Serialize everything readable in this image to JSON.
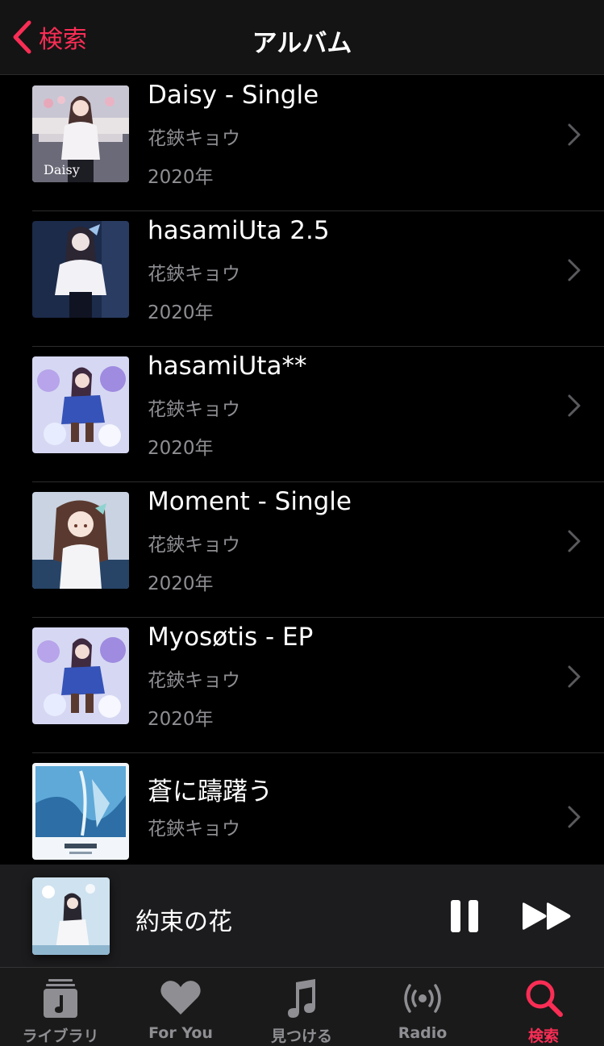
{
  "nav": {
    "back_label": "検索",
    "title": "アルバム"
  },
  "albums": [
    {
      "title": "Daisy - Single",
      "artist": "花鋏キョウ",
      "year": "2020年"
    },
    {
      "title": "hasamiUta 2.5",
      "artist": "花鋏キョウ",
      "year": "2020年"
    },
    {
      "title": "hasamiUta**",
      "artist": "花鋏キョウ",
      "year": "2020年"
    },
    {
      "title": "Moment - Single",
      "artist": "花鋏キョウ",
      "year": "2020年"
    },
    {
      "title": "Myosøtis - EP",
      "artist": "花鋏キョウ",
      "year": "2020年"
    },
    {
      "title": "蒼に躊躇う",
      "artist": "花鋏キョウ",
      "year": ""
    }
  ],
  "now_playing": {
    "song": "約束の花"
  },
  "tabs": [
    {
      "label": "ライブラリ",
      "icon": "library-icon"
    },
    {
      "label": "For You",
      "icon": "heart-icon"
    },
    {
      "label": "見つける",
      "icon": "music-note-icon"
    },
    {
      "label": "Radio",
      "icon": "radio-icon"
    },
    {
      "label": "検索",
      "icon": "search-icon"
    }
  ],
  "colors": {
    "accent": "#fa2d55",
    "secondary_text": "#8e8e93",
    "background": "#000000"
  }
}
